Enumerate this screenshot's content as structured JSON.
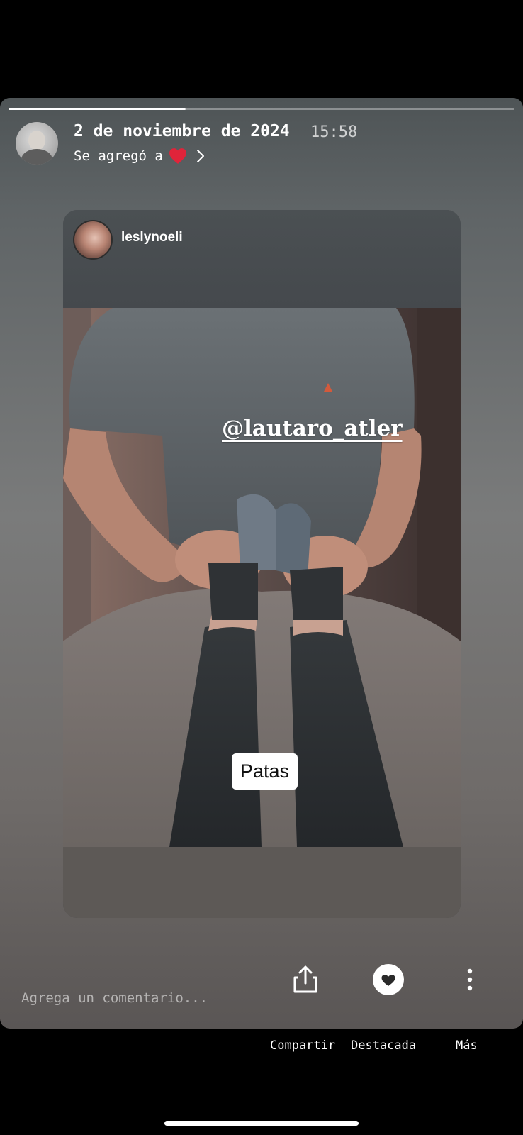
{
  "story": {
    "progress": 0.35,
    "date": "2 de noviembre de 2024",
    "time": "15:58",
    "added_to_prefix": "Se agregó a",
    "highlight_icon": "heart-icon",
    "accent_color": "#e0243a"
  },
  "post": {
    "username": "leslynoeli",
    "mention": "@lautaro_atler",
    "sticker_text": "Patas"
  },
  "footer": {
    "comment_placeholder": "Agrega un comentario...",
    "actions": [
      {
        "label": "Compartir",
        "icon": "share-icon"
      },
      {
        "label": "Destacada",
        "icon": "heart-circle-icon"
      },
      {
        "label": "Más",
        "icon": "more-vertical-icon"
      }
    ]
  }
}
